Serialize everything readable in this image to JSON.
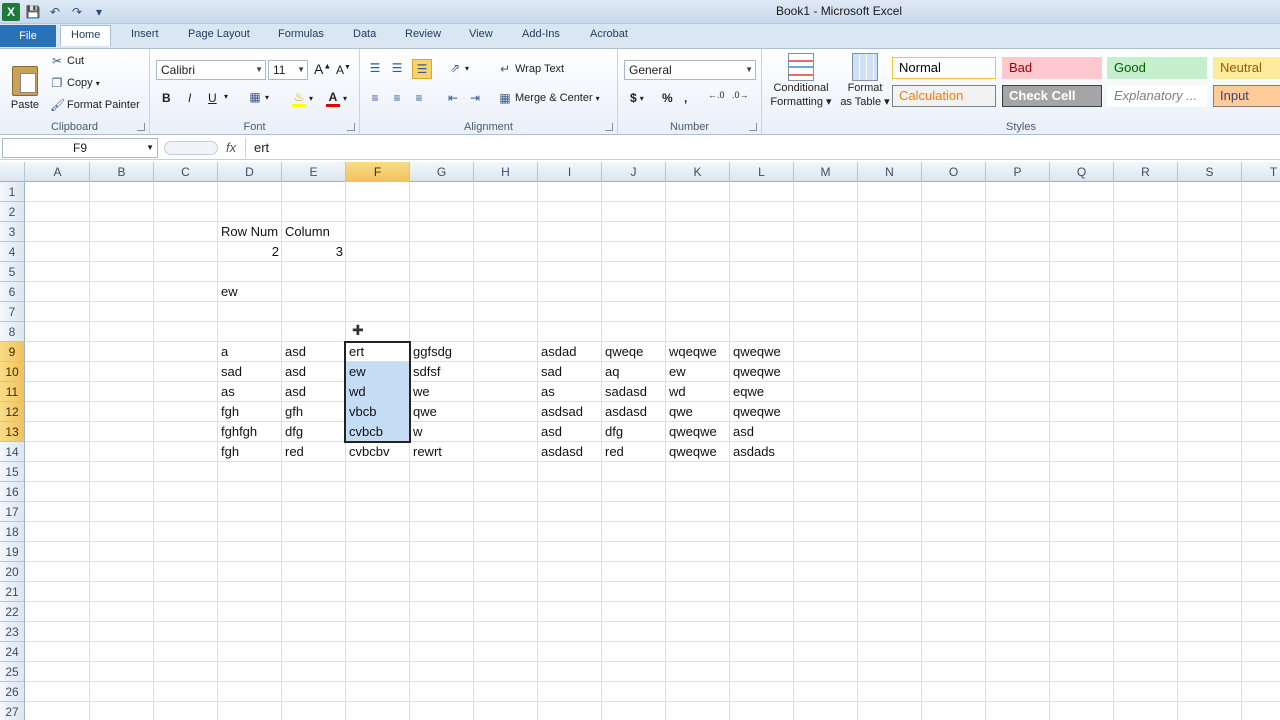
{
  "window": {
    "title": "Book1  -  Microsoft Excel"
  },
  "qat": {
    "app_icon": "X",
    "save_icon": "save-icon",
    "undo_icon": "undo-icon",
    "redo_icon": "redo-icon"
  },
  "tabs": [
    "File",
    "Home",
    "Insert",
    "Page Layout",
    "Formulas",
    "Data",
    "Review",
    "View",
    "Add-Ins",
    "Acrobat"
  ],
  "clipboard": {
    "label": "Clipboard",
    "paste": "Paste",
    "cut": "Cut",
    "copy": "Copy",
    "format_painter": "Format Painter"
  },
  "font": {
    "label": "Font",
    "name": "Calibri",
    "size": "11",
    "bold": "B",
    "italic": "I",
    "underline": "U"
  },
  "alignment": {
    "label": "Alignment",
    "wrap_text": "Wrap Text",
    "merge_center": "Merge & Center"
  },
  "number": {
    "label": "Number",
    "format": "General",
    "currency": "$",
    "percent": "%",
    "comma": ","
  },
  "styles": {
    "label": "Styles",
    "conditional": [
      "Conditional",
      "Formatting"
    ],
    "format_table": [
      "Format",
      "as Table"
    ],
    "cells": [
      {
        "name": "Normal",
        "bg": "#ffffff",
        "color": "#000000",
        "border": "#f5c242"
      },
      {
        "name": "Bad",
        "bg": "#ffc7ce",
        "color": "#9c0006",
        "border": "#ffc7ce"
      },
      {
        "name": "Good",
        "bg": "#c6efce",
        "color": "#006100",
        "border": "#c6efce"
      },
      {
        "name": "Neutral",
        "bg": "#ffeb9c",
        "color": "#9c5700",
        "border": "#ffeb9c"
      },
      {
        "name": "Calculation",
        "bg": "#f2f2f2",
        "color": "#fa7d00",
        "border": "#7f7f7f"
      },
      {
        "name": "Check Cell",
        "bg": "#a5a5a5",
        "color": "#ffffff",
        "border": "#3f3f3f"
      },
      {
        "name": "Explanatory ...",
        "bg": "#ffffff",
        "color": "#7f7f7f",
        "border": "#ffffff"
      },
      {
        "name": "Input",
        "bg": "#ffcc99",
        "color": "#3f3f76",
        "border": "#7f7f7f"
      }
    ]
  },
  "formula_bar": {
    "name_box": "F9",
    "fx": "fx",
    "content": "ert"
  },
  "sheet": {
    "columns": [
      "A",
      "B",
      "C",
      "D",
      "E",
      "F",
      "G",
      "H",
      "I",
      "J",
      "K",
      "L",
      "M",
      "N",
      "O",
      "P",
      "Q",
      "R",
      "S",
      "T"
    ],
    "rows": [
      "1",
      "2",
      "3",
      "4",
      "5",
      "6",
      "7",
      "8",
      "9",
      "10",
      "11",
      "12",
      "13",
      "14",
      "15",
      "16",
      "17",
      "18",
      "19",
      "20",
      "21",
      "22",
      "23",
      "24",
      "25",
      "26",
      "27"
    ],
    "selected_column": "F",
    "selected_rows": [
      "9",
      "10",
      "11",
      "12",
      "13"
    ],
    "cells": [
      {
        "ref": "D3",
        "v": "Row Num"
      },
      {
        "ref": "E3",
        "v": "Column"
      },
      {
        "ref": "D4",
        "v": "2",
        "num": true
      },
      {
        "ref": "E4",
        "v": "3",
        "num": true
      },
      {
        "ref": "D6",
        "v": "ew"
      },
      {
        "ref": "D9",
        "v": "a"
      },
      {
        "ref": "E9",
        "v": "asd"
      },
      {
        "ref": "F9",
        "v": "ert"
      },
      {
        "ref": "G9",
        "v": "ggfsdg"
      },
      {
        "ref": "I9",
        "v": "asdad"
      },
      {
        "ref": "J9",
        "v": "qweqe"
      },
      {
        "ref": "K9",
        "v": "wqeqwe"
      },
      {
        "ref": "L9",
        "v": "qweqwe"
      },
      {
        "ref": "D10",
        "v": "sad"
      },
      {
        "ref": "E10",
        "v": "asd"
      },
      {
        "ref": "F10",
        "v": "ew"
      },
      {
        "ref": "G10",
        "v": "sdfsf"
      },
      {
        "ref": "I10",
        "v": "sad"
      },
      {
        "ref": "J10",
        "v": "aq"
      },
      {
        "ref": "K10",
        "v": "ew"
      },
      {
        "ref": "L10",
        "v": "qweqwe"
      },
      {
        "ref": "D11",
        "v": "as"
      },
      {
        "ref": "E11",
        "v": "asd"
      },
      {
        "ref": "F11",
        "v": "wd"
      },
      {
        "ref": "G11",
        "v": "we"
      },
      {
        "ref": "I11",
        "v": "as"
      },
      {
        "ref": "J11",
        "v": "sadasd"
      },
      {
        "ref": "K11",
        "v": "wd"
      },
      {
        "ref": "L11",
        "v": "eqwe"
      },
      {
        "ref": "D12",
        "v": "fgh"
      },
      {
        "ref": "E12",
        "v": "gfh"
      },
      {
        "ref": "F12",
        "v": "vbcb"
      },
      {
        "ref": "G12",
        "v": "qwe"
      },
      {
        "ref": "I12",
        "v": "asdsad"
      },
      {
        "ref": "J12",
        "v": "asdasd"
      },
      {
        "ref": "K12",
        "v": "qwe"
      },
      {
        "ref": "L12",
        "v": "qweqwe"
      },
      {
        "ref": "D13",
        "v": "fghfgh"
      },
      {
        "ref": "E13",
        "v": "dfg"
      },
      {
        "ref": "F13",
        "v": "cvbcb"
      },
      {
        "ref": "G13",
        "v": "w"
      },
      {
        "ref": "I13",
        "v": "asd"
      },
      {
        "ref": "J13",
        "v": "dfg"
      },
      {
        "ref": "K13",
        "v": "qweqwe"
      },
      {
        "ref": "L13",
        "v": "asd"
      },
      {
        "ref": "D14",
        "v": "fgh"
      },
      {
        "ref": "E14",
        "v": "red"
      },
      {
        "ref": "F14",
        "v": "cvbcbv"
      },
      {
        "ref": "G14",
        "v": "rewrt"
      },
      {
        "ref": "I14",
        "v": "asdasd"
      },
      {
        "ref": "J14",
        "v": "red"
      },
      {
        "ref": "K14",
        "v": "qweqwe"
      },
      {
        "ref": "L14",
        "v": "asdads"
      }
    ]
  }
}
